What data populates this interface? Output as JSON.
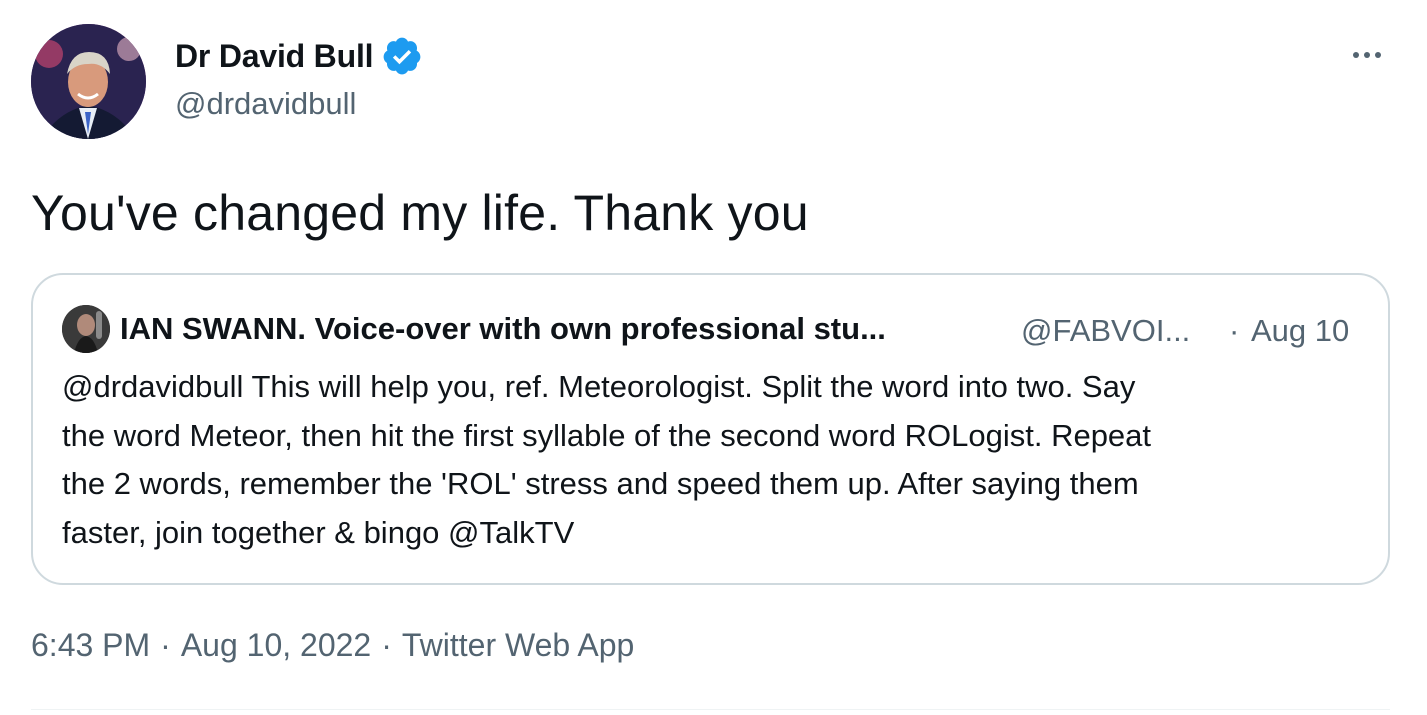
{
  "author": {
    "display_name": "Dr David Bull",
    "handle": "@drdavidbull",
    "verified": true
  },
  "tweet": {
    "text": "You've changed my life. Thank you"
  },
  "quoted_tweet": {
    "display_name": "IAN SWANN. Voice-over with own professional stu...",
    "handle": "@FABVOI...",
    "separator": "·",
    "date": "Aug 10",
    "text": "@drdavidbull This will help you, ref. Meteorologist. Split the word into two. Say\nthe word Meteor, then hit the first syllable of the second word ROLogist. Repeat\nthe 2 words, remember the 'ROL' stress and speed them up. After saying them\nfaster, join together & bingo @TalkTV"
  },
  "meta": {
    "time": "6:43 PM",
    "separator": "·",
    "date": "Aug 10, 2022",
    "source": "Twitter Web App"
  },
  "icons": {
    "verified": "verified-badge-icon",
    "more": "more-horizontal-icon"
  },
  "colors": {
    "text": "#0f1419",
    "secondary": "#536471",
    "verified": "#1d9bf0",
    "border": "#cfd9de"
  }
}
